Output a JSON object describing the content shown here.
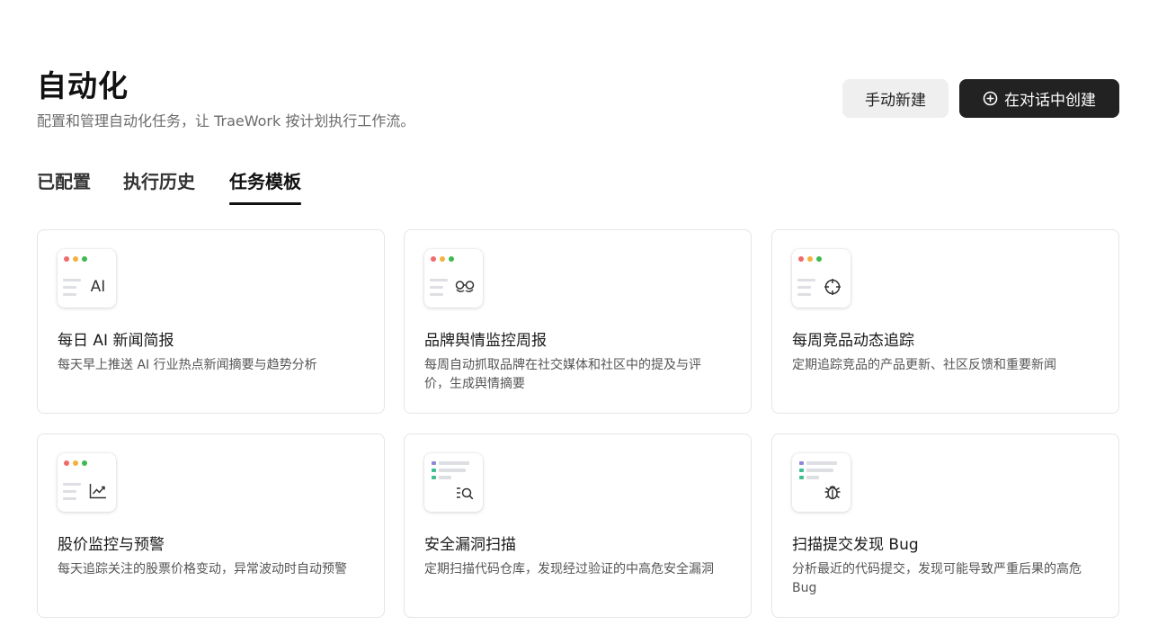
{
  "header": {
    "title": "自动化",
    "subtitle": "配置和管理自动化任务，让 TraeWork 按计划执行工作流。"
  },
  "actions": {
    "manual_label": "手动新建",
    "chat_label": "在对话中创建",
    "chat_icon": "plus-circle-icon"
  },
  "tabs": [
    {
      "label": "已配置",
      "active": false
    },
    {
      "label": "执行历史",
      "active": false
    },
    {
      "label": "任务模板",
      "active": true
    }
  ],
  "colors": {
    "primary_button": "#222222",
    "secondary_button": "#efefef",
    "dot_red": "#f16b6b",
    "dot_yellow": "#f3b23d",
    "dot_green": "#3fb950",
    "bar_purple": "#8e87d8",
    "bar_green": "#3fbf8f"
  },
  "templates": [
    {
      "title": "每日 AI 新闻简报",
      "desc": "每天早上推送 AI 行业热点新闻摘要与趋势分析",
      "icon": "ai-text-icon",
      "glyph": "AI",
      "thumb_style": "window"
    },
    {
      "title": "品牌舆情监控周报",
      "desc": "每周自动抓取品牌在社交媒体和社区中的提及与评价，生成舆情摘要",
      "icon": "glasses-icon",
      "thumb_style": "window"
    },
    {
      "title": "每周竞品动态追踪",
      "desc": "定期追踪竞品的产品更新、社区反馈和重要新闻",
      "icon": "crosshair-icon",
      "thumb_style": "window"
    },
    {
      "title": "股价监控与预警",
      "desc": "每天追踪关注的股票价格变动，异常波动时自动预警",
      "icon": "trend-chart-icon",
      "thumb_style": "window"
    },
    {
      "title": "安全漏洞扫描",
      "desc": "定期扫描代码仓库，发现经过验证的中高危安全漏洞",
      "icon": "list-search-icon",
      "thumb_style": "code"
    },
    {
      "title": "扫描提交发现 Bug",
      "desc": "分析最近的代码提交，发现可能导致严重后果的高危 Bug",
      "icon": "bug-icon",
      "thumb_style": "code"
    }
  ]
}
